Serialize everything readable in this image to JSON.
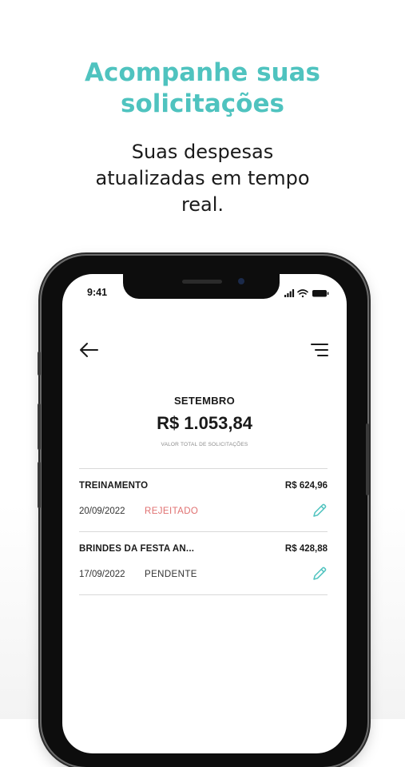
{
  "promo": {
    "headline_line1": "Acompanhe suas",
    "headline_line2": "solicitações",
    "subline_line1": "Suas despesas",
    "subline_line2": "atualizadas em tempo",
    "subline_line3": "real."
  },
  "colors": {
    "accent": "#4fc3bf",
    "rejected": "#e07070",
    "text": "#1a1a1a"
  },
  "status_bar": {
    "time": "9:41",
    "icons": [
      "signal-icon",
      "wifi-icon",
      "battery-icon"
    ]
  },
  "header": {
    "back_icon": "arrow-left-icon",
    "menu_icon": "filter-menu-icon"
  },
  "summary": {
    "month": "SETEMBRO",
    "total": "R$ 1.053,84",
    "total_label": "VALOR TOTAL DE SOLICITAÇÕES"
  },
  "requests": [
    {
      "title": "TREINAMENTO",
      "amount": "R$ 624,96",
      "date": "20/09/2022",
      "status": "REJEITADO"
    },
    {
      "title": "BRINDES DA FESTA AN...",
      "amount": "R$ 428,88",
      "date": "17/09/2022",
      "status": "PENDENTE"
    }
  ]
}
